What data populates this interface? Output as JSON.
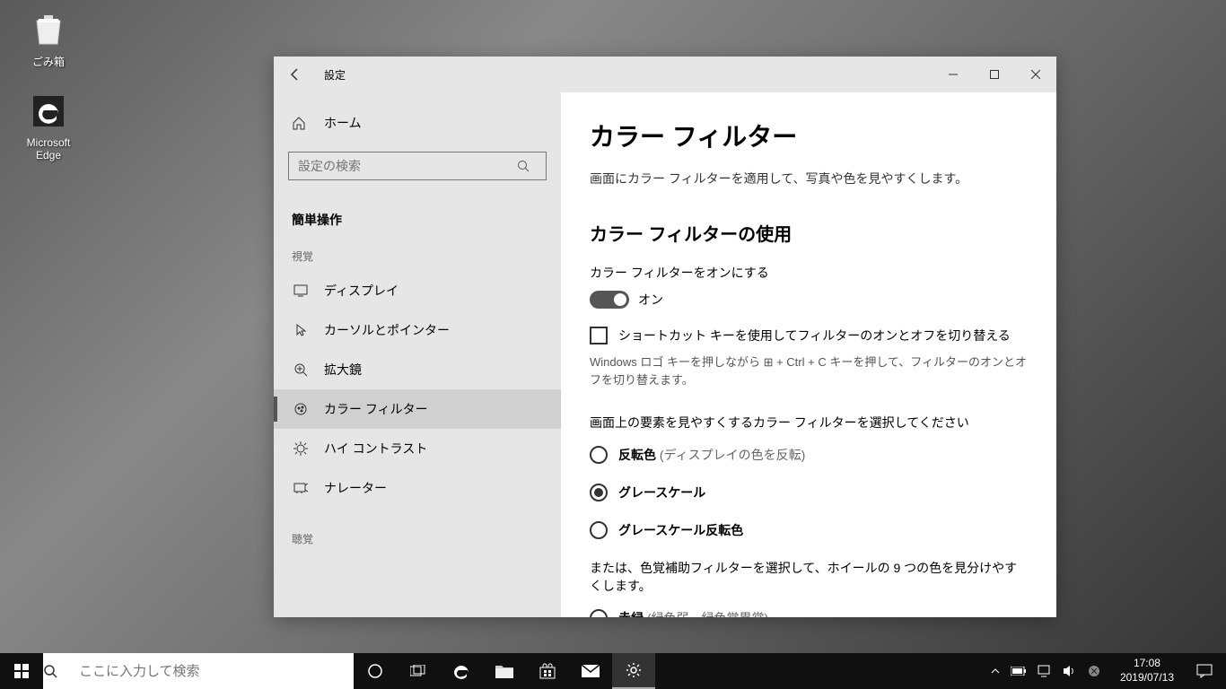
{
  "desktop": {
    "recycle_bin": "ごみ箱",
    "edge": "Microsoft Edge"
  },
  "window": {
    "title": "設定",
    "home": "ホーム",
    "search_placeholder": "設定の検索",
    "section": "簡単操作",
    "cat_visual": "視覚",
    "cat_hearing": "聴覚",
    "nav": {
      "display": "ディスプレイ",
      "cursor": "カーソルとポインター",
      "magnifier": "拡大鏡",
      "color_filter": "カラー フィルター",
      "high_contrast": "ハイ コントラスト",
      "narrator": "ナレーター"
    }
  },
  "content": {
    "h1": "カラー フィルター",
    "desc": "画面にカラー フィルターを適用して、写真や色を見やすくします。",
    "h2": "カラー フィルターの使用",
    "toggle_label": "カラー フィルターをオンにする",
    "toggle_state": "オン",
    "shortcut_checkbox": "ショートカット キーを使用してフィルターのオンとオフを切り替える",
    "shortcut_hint": "Windows ロゴ キーを押しながら ⊞ + Ctrl + C キーを押して、フィルターのオンとオフを切り替えます。",
    "select_label": "画面上の要素を見やすくするカラー フィルターを選択してください",
    "r1_bold": "反転色",
    "r1_sub": " (ディスプレイの色を反転)",
    "r2_bold": "グレースケール",
    "r3_bold": "グレースケール反転色",
    "cvd_label": "または、色覚補助フィルターを選択して、ホイールの 9 つの色を見分けやすくします。",
    "r4_bold": "赤緑",
    "r4_sub": " (緑色弱、緑色覚異常)"
  },
  "taskbar": {
    "search_placeholder": "ここに入力して検索",
    "time": "17:08",
    "date": "2019/07/13"
  }
}
